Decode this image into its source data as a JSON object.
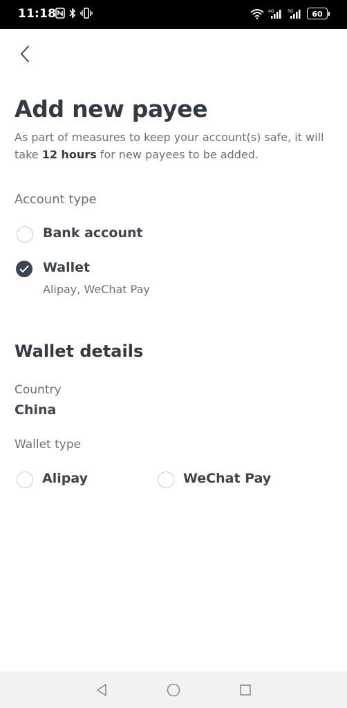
{
  "status_bar": {
    "time": "11:18",
    "battery": "60"
  },
  "header": {
    "title": "Add new payee",
    "intro_before": "As part of measures to keep your account(s) safe, it will take ",
    "intro_bold": "12 hours",
    "intro_after": " for new payees to be added."
  },
  "account_type": {
    "label": "Account type",
    "options": [
      {
        "label": "Bank account",
        "checked": false
      },
      {
        "label": "Wallet",
        "sublabel": "Alipay, WeChat Pay",
        "checked": true
      }
    ]
  },
  "wallet_details": {
    "heading": "Wallet details",
    "country_label": "Country",
    "country_value": "China",
    "wallet_type_label": "Wallet type",
    "wallet_types": [
      {
        "label": "Alipay",
        "checked": false
      },
      {
        "label": "WeChat Pay",
        "checked": false
      }
    ]
  },
  "colors": {
    "accent": "#3b4450",
    "text_primary": "#333a42",
    "text_secondary": "#6b7078"
  },
  "icons": {
    "back": "chevron-left-icon",
    "checked": "check-icon",
    "nav_back": "triangle-back-icon",
    "nav_home": "circle-home-icon",
    "nav_recents": "square-recents-icon"
  }
}
